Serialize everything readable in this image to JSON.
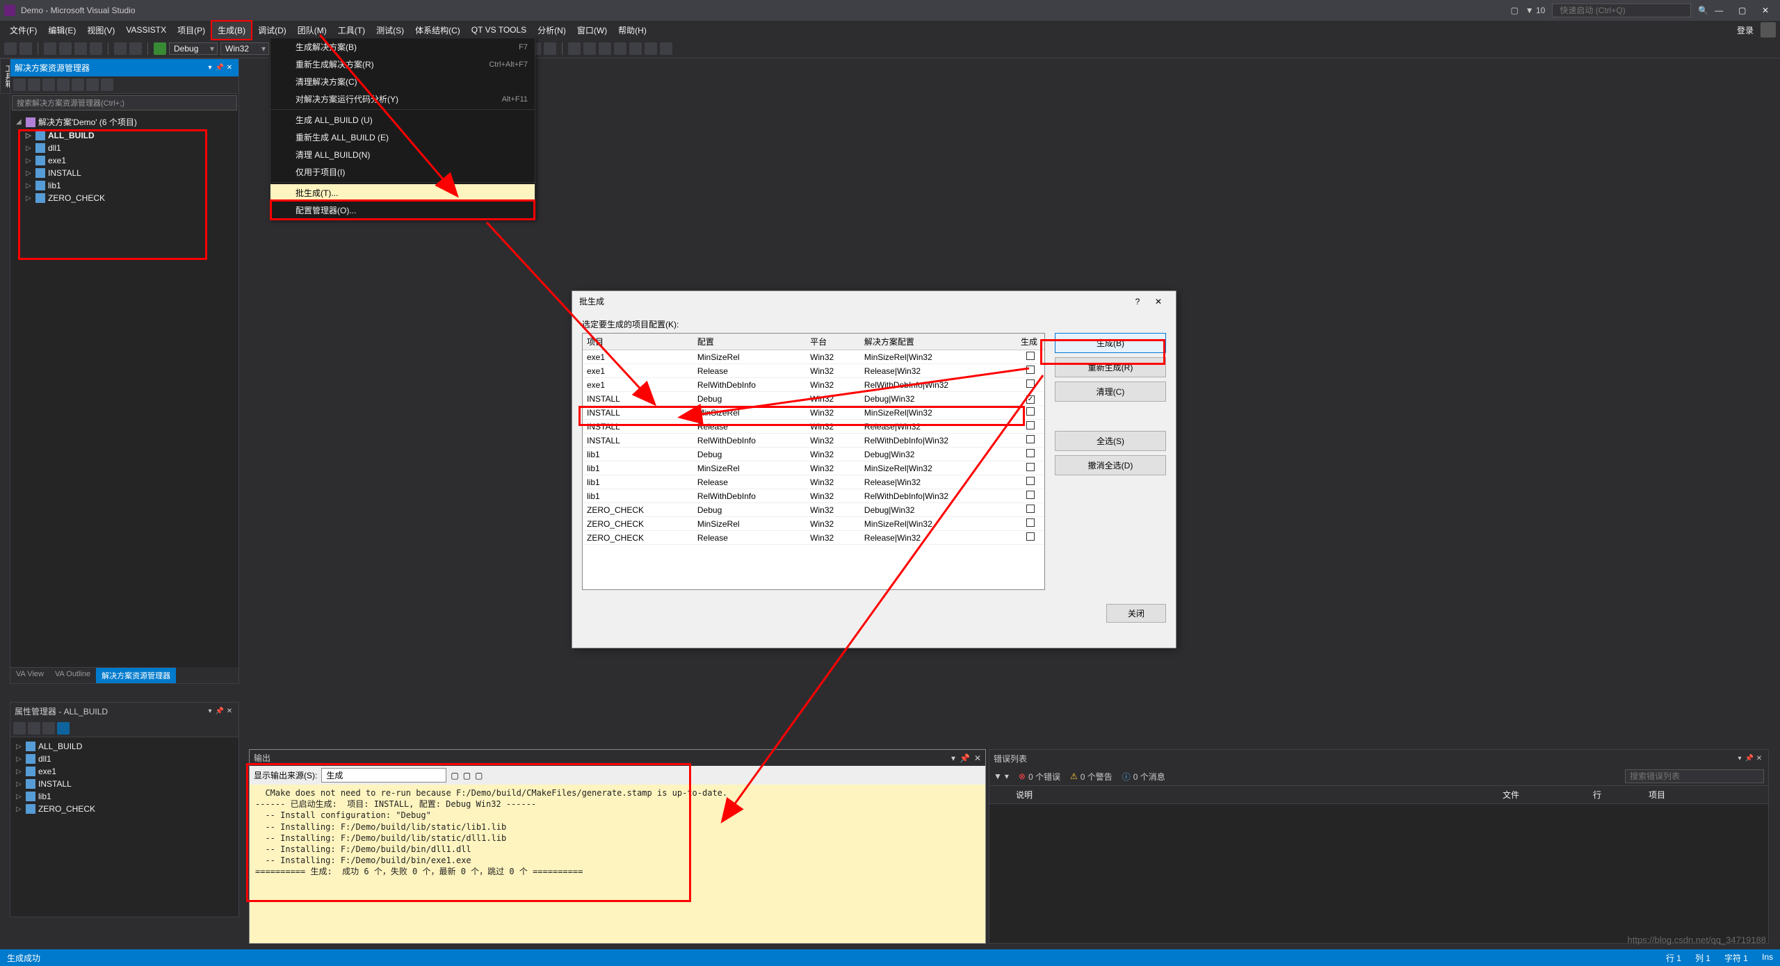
{
  "title": "Demo - Microsoft Visual Studio",
  "notifications": "10",
  "quick_launch_placeholder": "快速启动 (Ctrl+Q)",
  "login_label": "登录",
  "menu": {
    "file": "文件(F)",
    "edit": "编辑(E)",
    "view": "视图(V)",
    "vassistx": "VASSISTX",
    "project": "项目(P)",
    "build": "生成(B)",
    "debug": "调试(D)",
    "team": "团队(M)",
    "tools": "工具(T)",
    "test": "测试(S)",
    "arch": "体系结构(C)",
    "qtvs": "QT VS TOOLS",
    "analyze": "分析(N)",
    "window": "窗口(W)",
    "help": "帮助(H)"
  },
  "toolbar": {
    "config": "Debug",
    "platform": "Win32"
  },
  "dropdown": [
    {
      "label": "生成解决方案(B)",
      "shortcut": "F7"
    },
    {
      "label": "重新生成解决方案(R)",
      "shortcut": "Ctrl+Alt+F7"
    },
    {
      "label": "清理解决方案(C)",
      "shortcut": ""
    },
    {
      "label": "对解决方案运行代码分析(Y)",
      "shortcut": "Alt+F11"
    },
    {
      "sep": true
    },
    {
      "label": "生成 ALL_BUILD (U)",
      "shortcut": ""
    },
    {
      "label": "重新生成 ALL_BUILD (E)",
      "shortcut": ""
    },
    {
      "label": "清理 ALL_BUILD(N)",
      "shortcut": ""
    },
    {
      "label": "仅用于项目(I)",
      "shortcut": ""
    },
    {
      "sep": true
    },
    {
      "label": "批生成(T)...",
      "shortcut": "",
      "highlight": true
    },
    {
      "label": "配置管理器(O)...",
      "shortcut": ""
    }
  ],
  "vert_tab": "工具箱",
  "solution": {
    "panel_title": "解决方案资源管理器",
    "search_placeholder": "搜索解决方案资源管理器(Ctrl+;)",
    "root": "解决方案'Demo' (6 个项目)",
    "items": [
      "ALL_BUILD",
      "dll1",
      "exe1",
      "INSTALL",
      "lib1",
      "ZERO_CHECK"
    ]
  },
  "sol_tabs": {
    "va_view": "VA View",
    "va_outline": "VA Outline",
    "sol": "解决方案资源管理器"
  },
  "prop": {
    "title": "属性管理器 - ALL_BUILD",
    "items": [
      "ALL_BUILD",
      "dll1",
      "exe1",
      "INSTALL",
      "lib1",
      "ZERO_CHECK"
    ]
  },
  "dialog": {
    "title": "批生成",
    "subtitle": "选定要生成的项目配置(K):",
    "cols": {
      "project": "项目",
      "config": "配置",
      "platform": "平台",
      "sol_config": "解决方案配置",
      "build": "生成"
    },
    "rows": [
      {
        "p": "exe1",
        "c": "MinSizeRel",
        "pl": "Win32",
        "s": "MinSizeRel|Win32",
        "chk": false
      },
      {
        "p": "exe1",
        "c": "Release",
        "pl": "Win32",
        "s": "Release|Win32",
        "chk": false
      },
      {
        "p": "exe1",
        "c": "RelWithDebInfo",
        "pl": "Win32",
        "s": "RelWithDebInfo|Win32",
        "chk": false
      },
      {
        "p": "INSTALL",
        "c": "Debug",
        "pl": "Win32",
        "s": "Debug|Win32",
        "chk": true
      },
      {
        "p": "INSTALL",
        "c": "MinSizeRel",
        "pl": "Win32",
        "s": "MinSizeRel|Win32",
        "chk": false
      },
      {
        "p": "INSTALL",
        "c": "Release",
        "pl": "Win32",
        "s": "Release|Win32",
        "chk": false
      },
      {
        "p": "INSTALL",
        "c": "RelWithDebInfo",
        "pl": "Win32",
        "s": "RelWithDebInfo|Win32",
        "chk": false
      },
      {
        "p": "lib1",
        "c": "Debug",
        "pl": "Win32",
        "s": "Debug|Win32",
        "chk": false
      },
      {
        "p": "lib1",
        "c": "MinSizeRel",
        "pl": "Win32",
        "s": "MinSizeRel|Win32",
        "chk": false
      },
      {
        "p": "lib1",
        "c": "Release",
        "pl": "Win32",
        "s": "Release|Win32",
        "chk": false
      },
      {
        "p": "lib1",
        "c": "RelWithDebInfo",
        "pl": "Win32",
        "s": "RelWithDebInfo|Win32",
        "chk": false
      },
      {
        "p": "ZERO_CHECK",
        "c": "Debug",
        "pl": "Win32",
        "s": "Debug|Win32",
        "chk": false
      },
      {
        "p": "ZERO_CHECK",
        "c": "MinSizeRel",
        "pl": "Win32",
        "s": "MinSizeRel|Win32",
        "chk": false
      },
      {
        "p": "ZERO_CHECK",
        "c": "Release",
        "pl": "Win32",
        "s": "Release|Win32",
        "chk": false
      }
    ],
    "btn_build": "生成(B)",
    "btn_rebuild": "重新生成(R)",
    "btn_clean": "清理(C)",
    "btn_select_all": "全选(S)",
    "btn_deselect": "撤消全选(D)",
    "btn_close": "关闭"
  },
  "output": {
    "title": "输出",
    "show_from_label": "显示输出来源(S):",
    "show_from_value": "生成",
    "lines": [
      "  CMake does not need to re-run because F:/Demo/build/CMakeFiles/generate.stamp is up-to-date.",
      "------ 已启动生成:  项目: INSTALL, 配置: Debug Win32 ------",
      "  -- Install configuration: \"Debug\"",
      "  -- Installing: F:/Demo/build/lib/static/lib1.lib",
      "  -- Installing: F:/Demo/build/lib/static/dll1.lib",
      "  -- Installing: F:/Demo/build/bin/dll1.dll",
      "  -- Installing: F:/Demo/build/bin/exe1.exe",
      "========== 生成:  成功 6 个，失败 0 个，最新 0 个，跳过 0 个 =========="
    ]
  },
  "error_list": {
    "title": "错误列表",
    "filter_dropdown": "▼",
    "errors": "0 个错误",
    "warnings": "0 个警告",
    "messages": "0 个消息",
    "search_placeholder": "搜索错误列表",
    "cols": {
      "desc": "说明",
      "file": "文件",
      "line": "行",
      "project": "项目"
    }
  },
  "status": {
    "text": "生成成功",
    "line": "行 1",
    "col": "列 1",
    "ch": "字符 1",
    "ins": "Ins"
  },
  "watermark": "https://blog.csdn.net/qq_34719188"
}
